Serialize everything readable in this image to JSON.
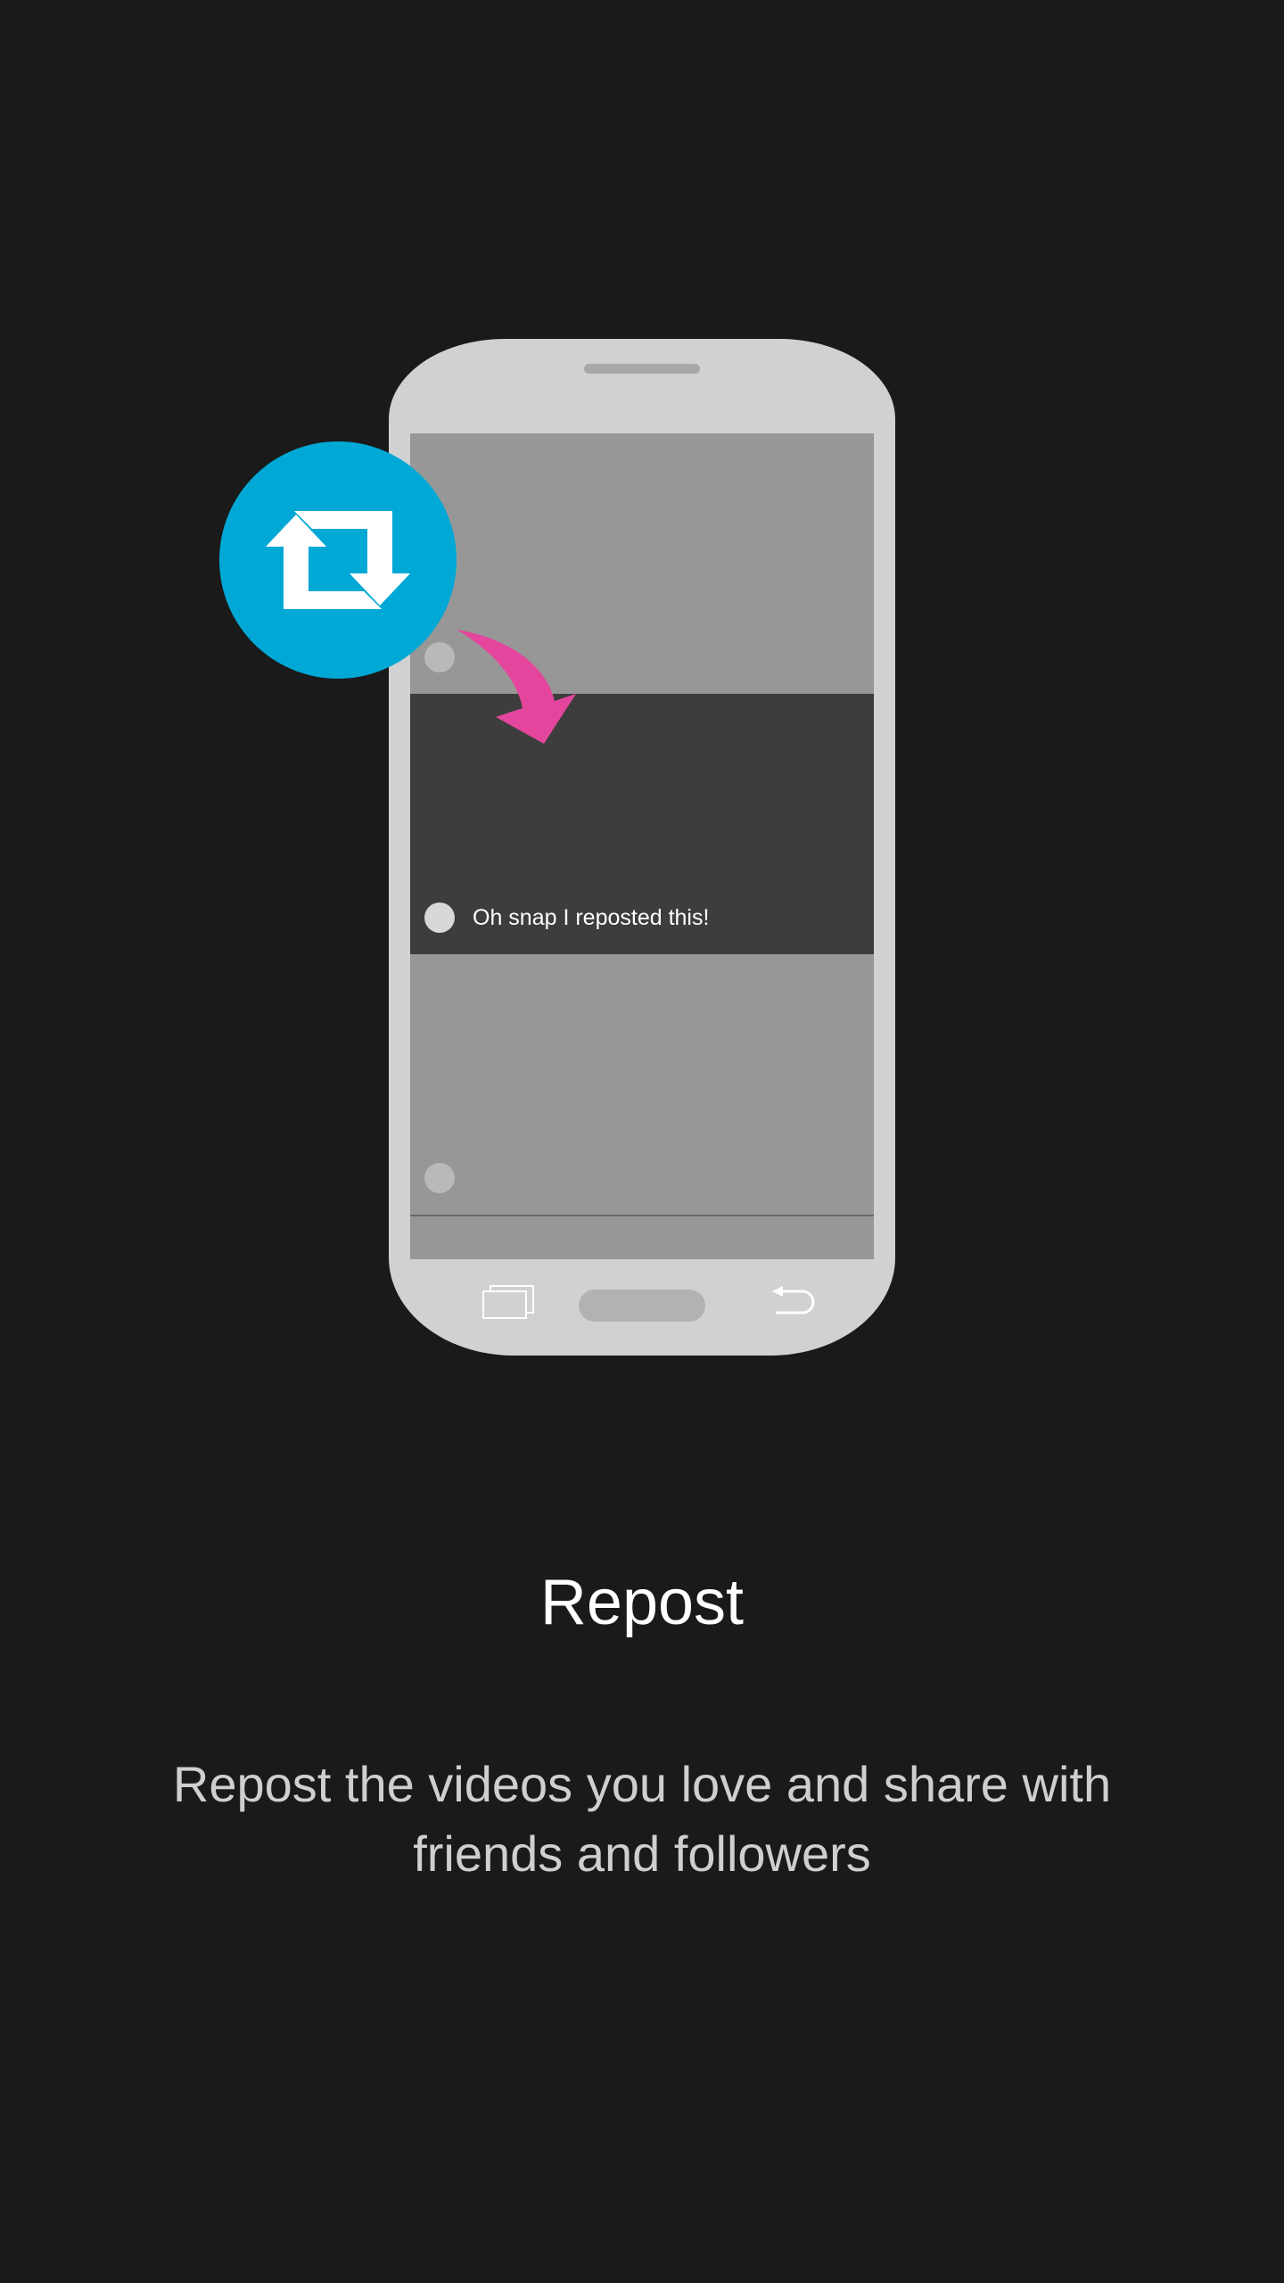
{
  "illustration": {
    "caption": "Oh snap I reposted this!",
    "badge_icon": "repost-icon",
    "badge_color": "#00a8d6",
    "arrow_color": "#e5469d"
  },
  "intro": {
    "title": "Repost",
    "description": "Repost the videos you love and share with friends and followers"
  }
}
